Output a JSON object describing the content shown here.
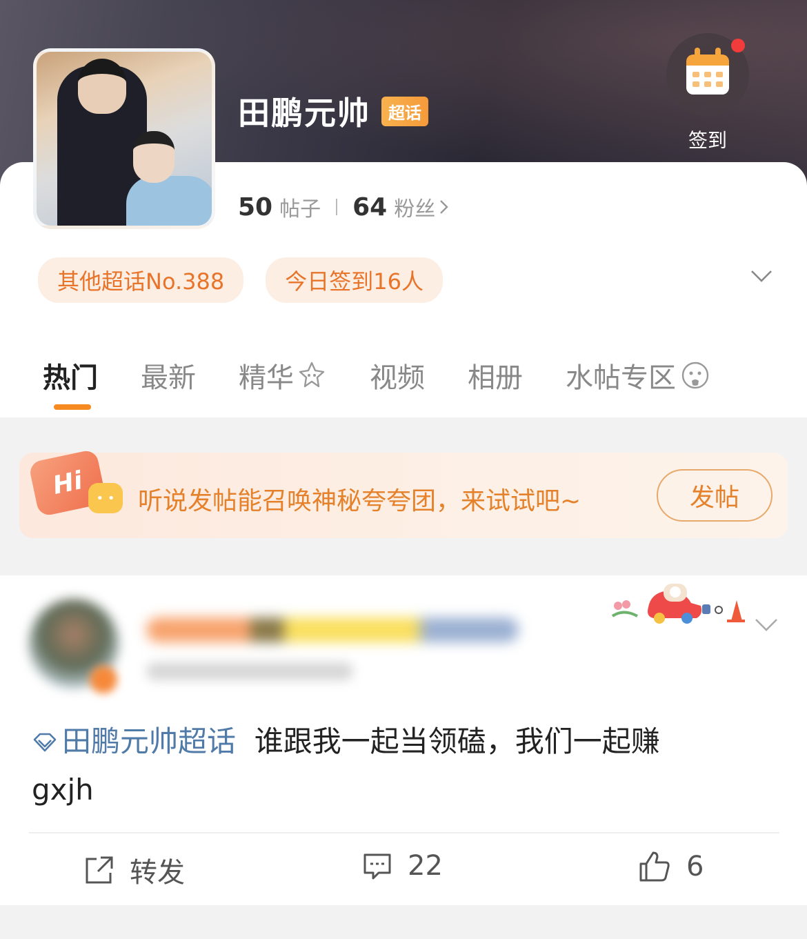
{
  "header": {
    "title": "田鹏元帅",
    "badge": "超话",
    "checkin_label": "签到",
    "stats": {
      "posts_count": "50",
      "posts_label": "帖子",
      "fans_count": "64",
      "fans_label": "粉丝"
    },
    "pills": [
      "其他超话No.388",
      "今日签到16人"
    ]
  },
  "tabs": [
    "热门",
    "最新",
    "精华",
    "视频",
    "相册",
    "水帖专区"
  ],
  "active_tab": "热门",
  "banner": {
    "hi_label": "Hi",
    "text": "听说发帖能召唤神秘夸夸团，来试试吧~",
    "button": "发帖"
  },
  "post": {
    "topic": "田鹏元帅超话",
    "body_line1": "谁跟我一起当领磕，我们一起赚",
    "body_line2": "gxjh",
    "repost_label": "转发",
    "comment_count": "22",
    "like_count": "6"
  },
  "colors": {
    "accent_orange": "#f6891f",
    "pill_bg": "#fdeee3",
    "pill_text": "#e8742a",
    "topic_link": "#507aa8",
    "notification_dot": "#f23b3b"
  },
  "icons": [
    "calendar-icon",
    "chevron-right-icon",
    "chevron-down-icon",
    "sparkle-icon",
    "smiley-icon",
    "gem-icon",
    "share-icon",
    "comment-icon",
    "like-icon"
  ]
}
